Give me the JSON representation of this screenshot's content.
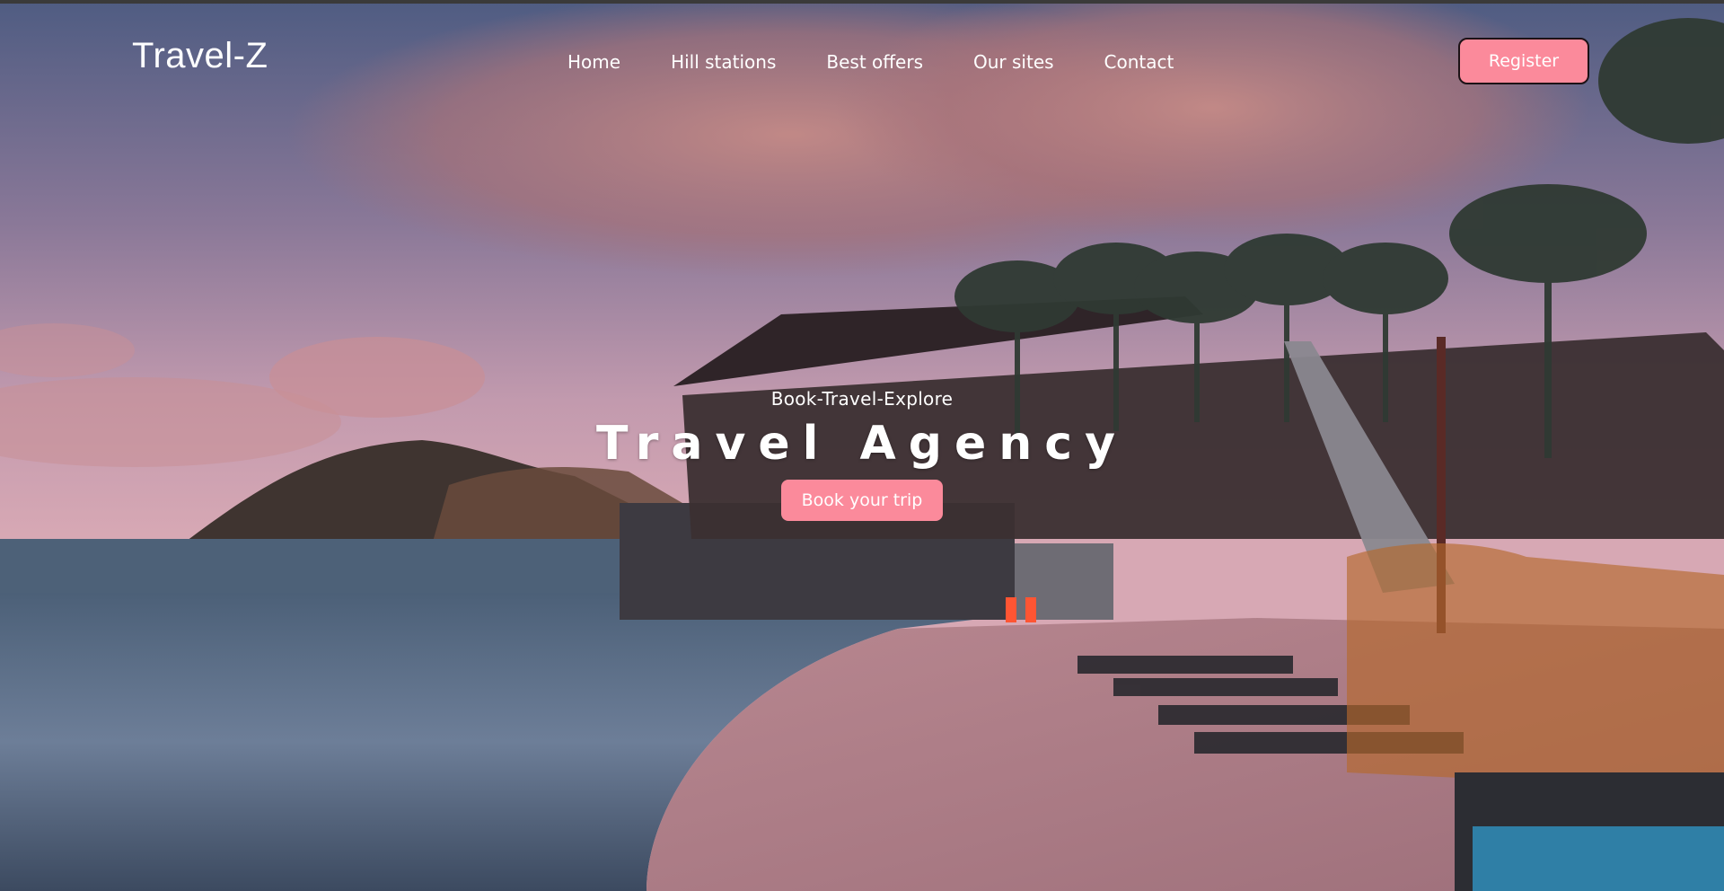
{
  "brand": {
    "name": "Travel-Z"
  },
  "nav": {
    "items": [
      {
        "label": "Home"
      },
      {
        "label": "Hill stations"
      },
      {
        "label": "Best offers"
      },
      {
        "label": "Our sites"
      },
      {
        "label": "Contact"
      }
    ],
    "register_label": "Register"
  },
  "hero": {
    "tagline": "Book-Travel-Explore",
    "title": "Travel Agency",
    "cta_label": "Book your trip"
  },
  "colors": {
    "accent": "#fb8a9b",
    "text": "#ffffff"
  }
}
